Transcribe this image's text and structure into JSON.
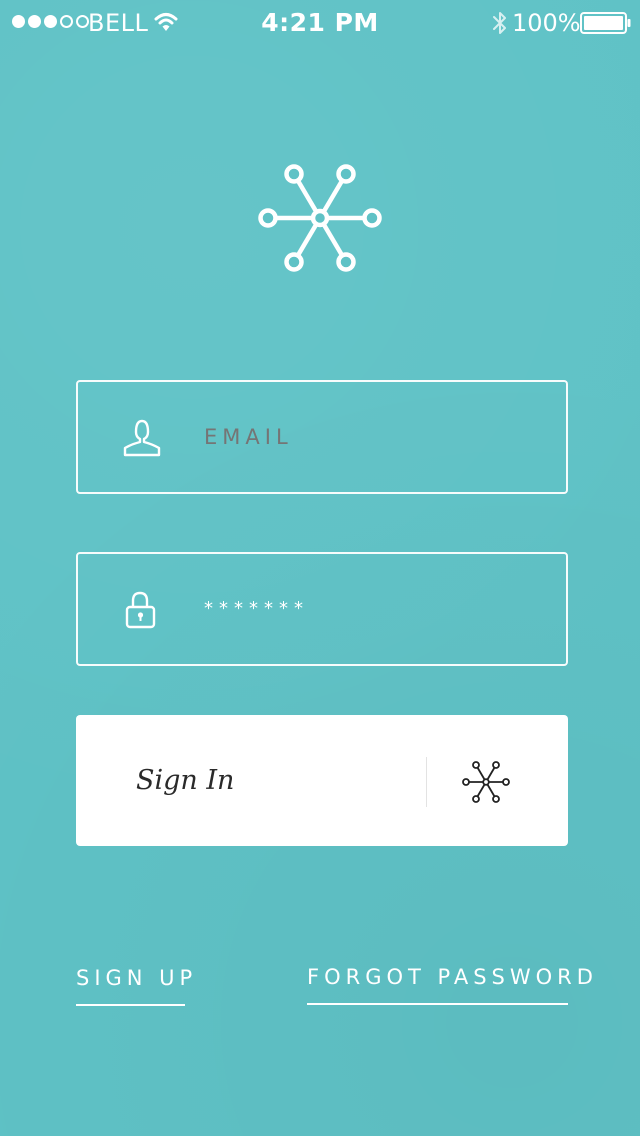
{
  "status_bar": {
    "carrier": "BELL",
    "time": "4:21 PM",
    "battery": "100%",
    "signal_bars_filled": 3,
    "signal_bars_total": 5,
    "icons": [
      "signal-dots",
      "wifi-icon",
      "bluetooth-icon",
      "battery-icon"
    ]
  },
  "logo": {
    "icon": "asterisk-network-icon"
  },
  "form": {
    "email": {
      "placeholder": "EMAIL",
      "icon": "user-icon"
    },
    "password": {
      "value": "*******",
      "icon": "lock-icon"
    },
    "signin": {
      "label": "Sign In",
      "icon": "asterisk-network-icon"
    }
  },
  "links": {
    "signup": "SIGN UP",
    "forgot": "FORGOT PASSWORD"
  },
  "colors": {
    "background": "#5fc2c6",
    "foreground": "#ffffff",
    "button_background": "#ffffff",
    "button_text": "#2a2a2a"
  }
}
